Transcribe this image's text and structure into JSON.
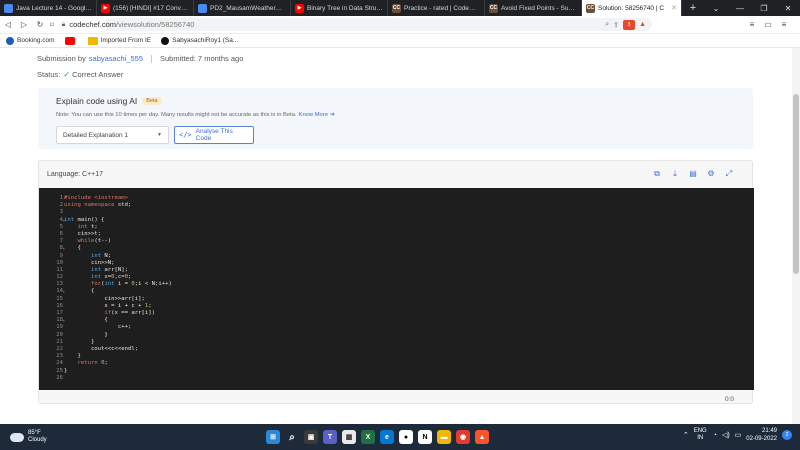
{
  "browser": {
    "tabs": [
      {
        "title": "Java Lecture 14 - Google D",
        "icon_color": "#4a8af4",
        "fav": ""
      },
      {
        "title": "(156) [HINDI] #17 Converti",
        "icon_color": "#ff0000",
        "fav": ""
      },
      {
        "title": "PD2_MausamWeatherApp:",
        "icon_color": "#4a8af4",
        "fav": ""
      },
      {
        "title": "Binary Tree in Data Structu",
        "icon_color": "#ff0000",
        "fav": ""
      },
      {
        "title": "Practice - rated | CodeChef",
        "icon_color": "#6b4f3a",
        "fav": "CC"
      },
      {
        "title": "Avoid Fixed Points - Subm",
        "icon_color": "#6b4f3a",
        "fav": "CC"
      },
      {
        "title": "Solution: 58256740 | C",
        "icon_color": "#6b4f3a",
        "fav": "CC",
        "active": true
      }
    ],
    "new_tab": "+",
    "url_host": "codechef.com",
    "url_path": "/viewsolution/58256740",
    "ext_badge": "3",
    "bookmarks": [
      {
        "label": "Booking.com",
        "color": "#1a5fb4"
      },
      {
        "label": "",
        "color": "#ff0000"
      },
      {
        "label": "Imported From IE",
        "color": "#f2b705"
      },
      {
        "label": "SabyasachiRoy1 (Sa...",
        "color": "#111111"
      }
    ]
  },
  "page": {
    "submission_prefix": "Submission by",
    "submitter": "sabyasachi_555",
    "submitted": "Submitted: 7 months ago",
    "status_label": "Status:",
    "status_value": "Correct Answer",
    "ai": {
      "title": "Explain code using AI",
      "beta": "Beta",
      "note": "Note: You can use this 10 times per day. Many results might not be accurate as this is in Beta.",
      "know_more": "Know More",
      "select_value": "Detailed Explanation 1",
      "analyse_label": "Analyse This Code"
    },
    "code": {
      "language": "Language: C++17",
      "cursor_pos": "0:0",
      "lines": [
        "#include <iostream>",
        "using namespace std;",
        "",
        "int main() {",
        "    int t;",
        "    cin>>t;",
        "    while(t--)",
        "    {",
        "        int N;",
        "        cin>>N;",
        "        int arr[N];",
        "        int x=0,c=0;",
        "        for(int i = 0;i < N;i++)",
        "        {",
        "            cin>>arr[i];",
        "            x = i + c + 1;",
        "            if(x == arr[i])",
        "            {",
        "                c++;",
        "            }",
        "        }",
        "        cout<<c<<endl;",
        "    }",
        "    return 0;",
        "}",
        ""
      ],
      "line_numbers": [
        "1",
        "2",
        "3",
        "4",
        "5",
        "6",
        "7",
        "8",
        "9",
        "10",
        "11",
        "12",
        "13",
        "14",
        "15",
        "16",
        "17",
        "18",
        "19",
        "20",
        "21",
        "22",
        "23",
        "24",
        "25",
        "26"
      ]
    }
  },
  "taskbar": {
    "temp": "85°F",
    "weather": "Cloudy",
    "lang_top": "ENG",
    "lang_bottom": "IN",
    "time": "21:49",
    "date": "02-09-2022",
    "notif_count": "2"
  }
}
